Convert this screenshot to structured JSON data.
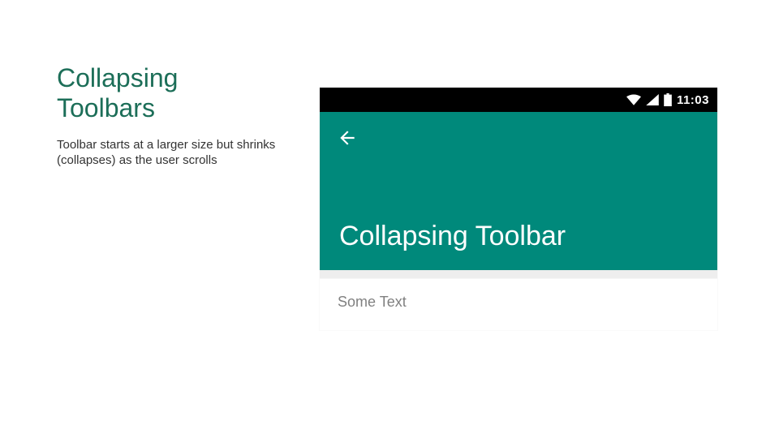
{
  "slide": {
    "heading_line1": "Collapsing",
    "heading_line2": "Toolbars",
    "description": "Toolbar starts at a larger size but shrinks (collapses) as the user scrolls"
  },
  "phone": {
    "status": {
      "time": "11:03"
    },
    "appbar": {
      "title": "Collapsing Toolbar"
    },
    "content": {
      "line": "Some Text"
    }
  },
  "colors": {
    "accent_heading": "#1c6e58",
    "appbar_teal": "#00897b",
    "statusbar": "#000000"
  }
}
